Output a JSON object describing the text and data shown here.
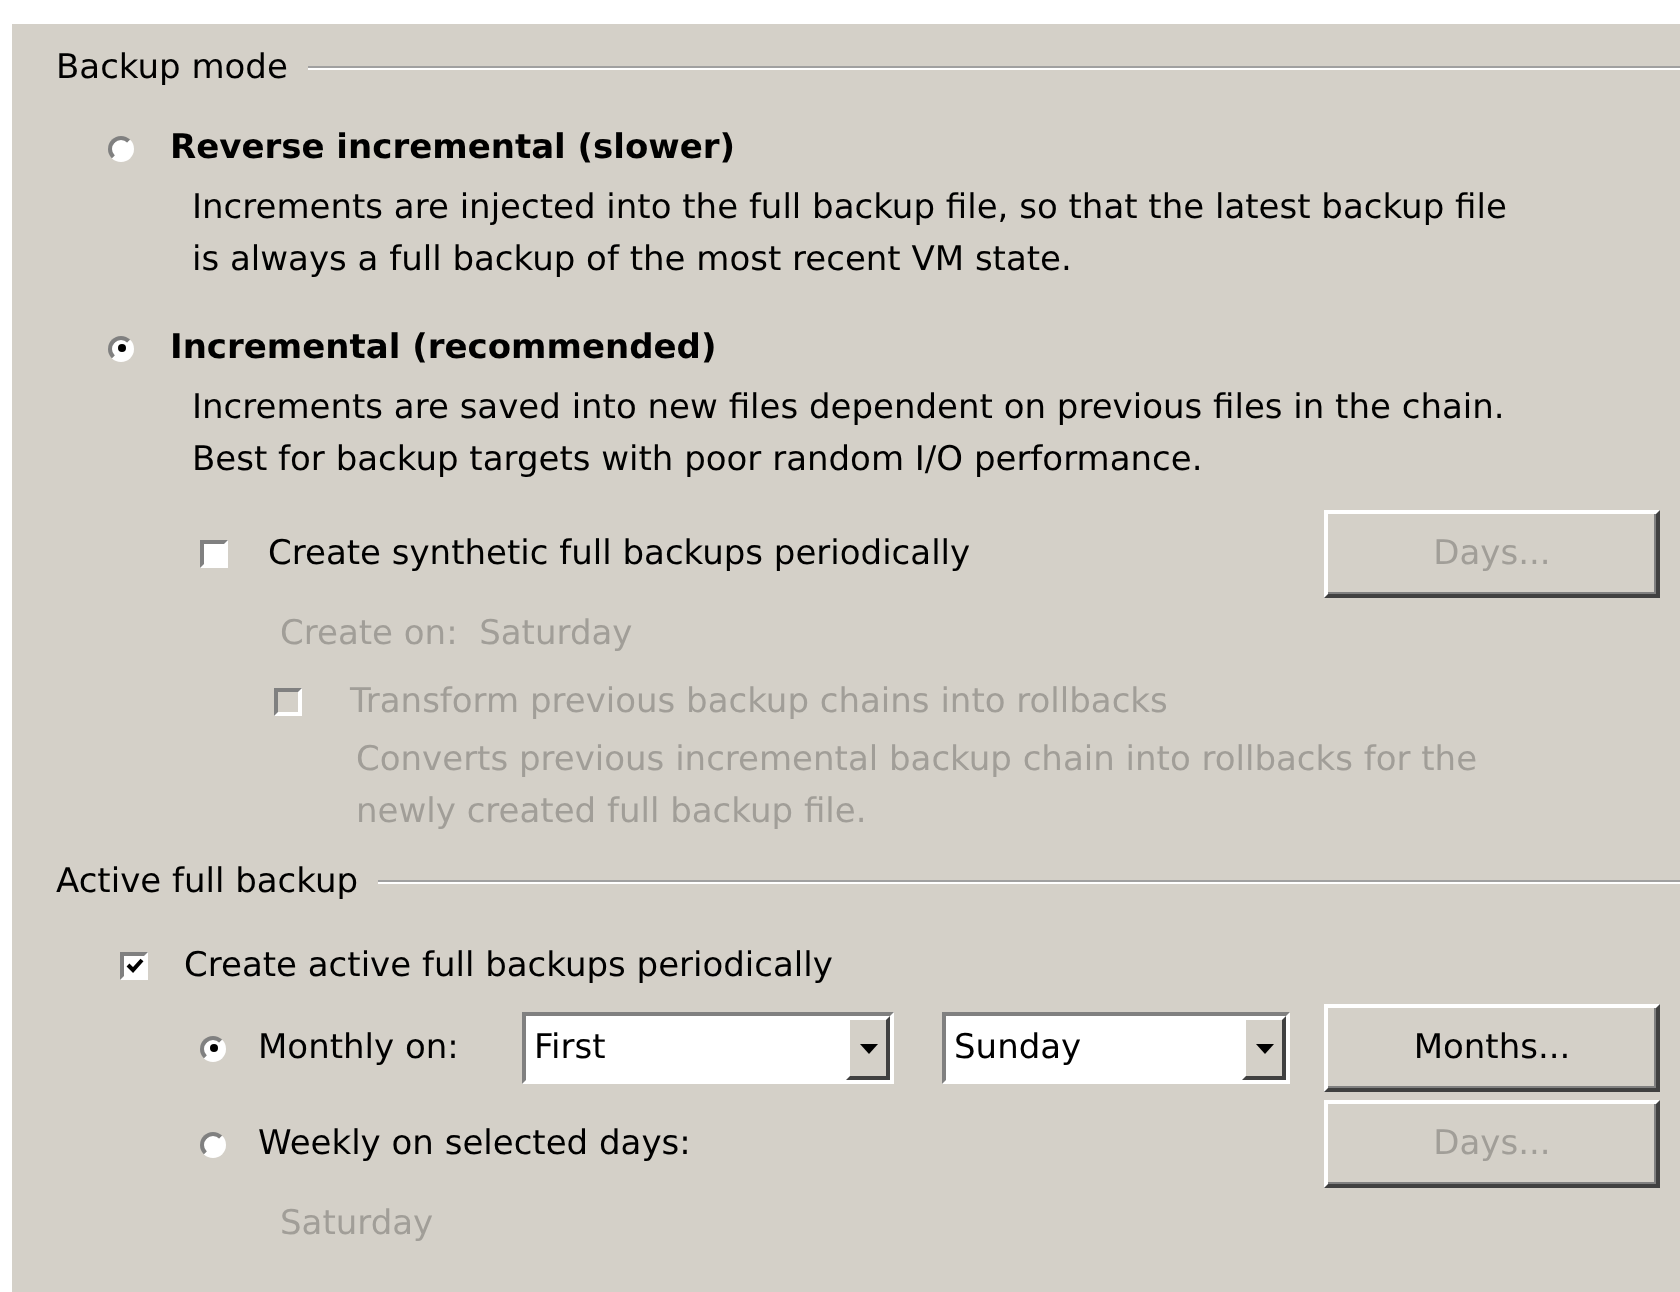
{
  "backup_mode": {
    "title": "Backup mode",
    "options": [
      {
        "label": "Reverse incremental (slower)",
        "selected": false,
        "description": "Increments are injected into the full backup file, so that the latest backup file\nis always a full backup of the most recent VM state."
      },
      {
        "label": "Incremental (recommended)",
        "selected": true,
        "description": "Increments are saved into new files dependent on previous files in the chain.\nBest for backup targets with poor random I/O performance."
      }
    ],
    "synthetic": {
      "label": "Create synthetic full backups periodically",
      "checked": false,
      "button": {
        "label": "Days...",
        "disabled": true
      },
      "note": "Create on:  Saturday",
      "note_disabled": true
    },
    "transform": {
      "label": "Transform previous backup chains into rollbacks",
      "checked": false,
      "disabled": true,
      "description": "Converts previous incremental backup chain into rollbacks for the\nnewly created full backup file."
    }
  },
  "active_full": {
    "title": "Active full backup",
    "checkbox": {
      "label": "Create active full backups periodically",
      "checked": true
    },
    "options": [
      {
        "kind": "monthly",
        "label": "Monthly on:",
        "selected": true,
        "dropdowns": [
          {
            "value": "First"
          },
          {
            "value": "Sunday"
          }
        ],
        "button": {
          "label": "Months...",
          "disabled": false
        }
      },
      {
        "kind": "weekly",
        "label": "Weekly on selected days:",
        "selected": false,
        "button": {
          "label": "Days...",
          "disabled": true
        },
        "note": "Saturday",
        "note_disabled": true
      }
    ]
  }
}
